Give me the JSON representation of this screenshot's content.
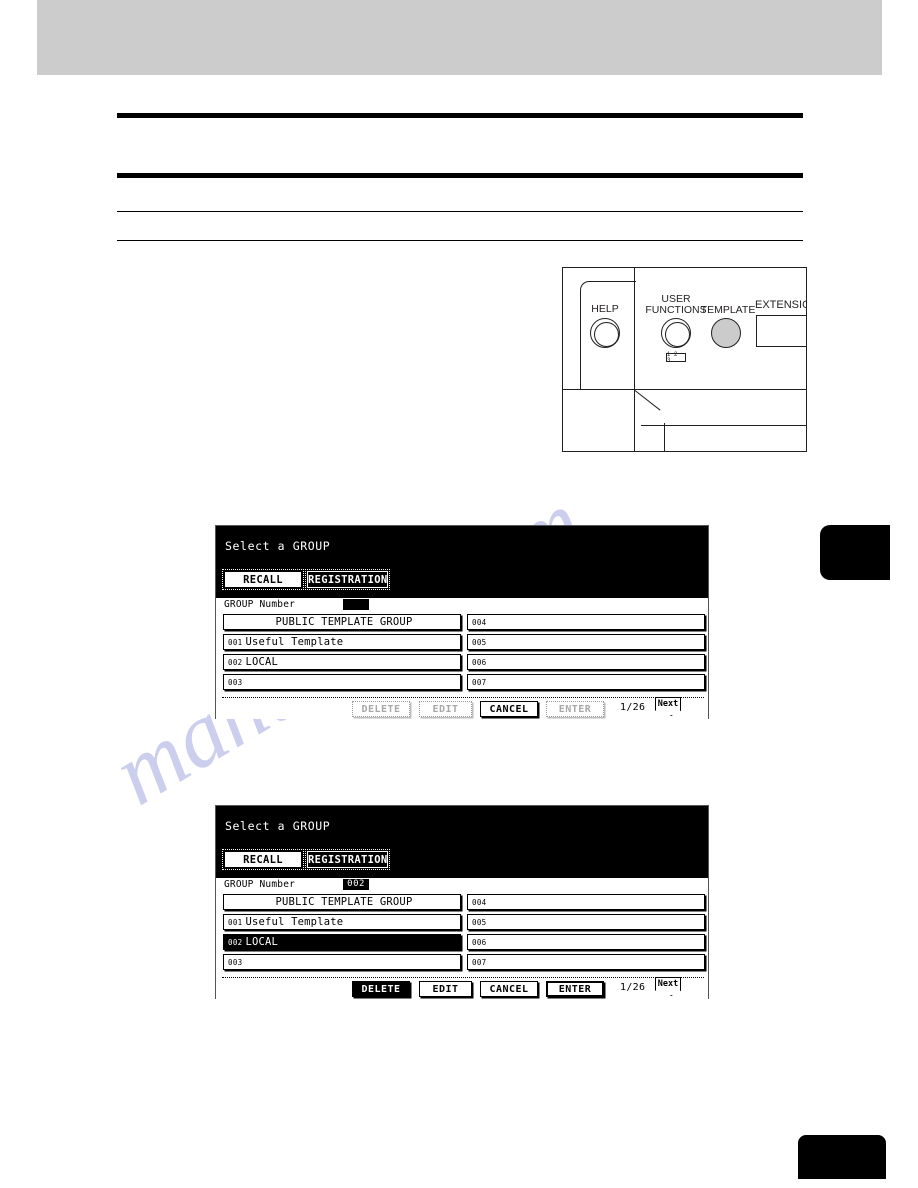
{
  "page": {
    "watermark_line1": "manualshive",
    "watermark_line2": ".com"
  },
  "control_panel": {
    "keys": [
      {
        "name": "help-key",
        "label_line1": "HELP",
        "label_line2": "",
        "state": "normal"
      },
      {
        "name": "user-functions-key",
        "label_line1": "USER",
        "label_line2": "FUNCTIONS",
        "state": "normal",
        "badge": "1 2 3"
      },
      {
        "name": "template-key",
        "label_line1": "TEMPLATE",
        "label_line2": "",
        "state": "highlighted"
      }
    ],
    "extension_label": "EXTENSION"
  },
  "screens": [
    {
      "id": "screen-recall",
      "title": "Select a GROUP",
      "tabs": [
        {
          "label": "RECALL",
          "active": false
        },
        {
          "label": "REGISTRATION",
          "active": true
        }
      ],
      "group_number": {
        "label": "GROUP Number",
        "value": ""
      },
      "groups_left": [
        {
          "index": "",
          "name": "PUBLIC TEMPLATE GROUP",
          "selected": false,
          "centered": true
        },
        {
          "index": "001",
          "name": "Useful Template",
          "selected": false,
          "centered": false
        },
        {
          "index": "002",
          "name": "LOCAL",
          "selected": false,
          "centered": false
        },
        {
          "index": "003",
          "name": "",
          "selected": false,
          "centered": false
        }
      ],
      "groups_right": [
        {
          "index": "004",
          "name": "",
          "selected": false,
          "centered": false
        },
        {
          "index": "005",
          "name": "",
          "selected": false,
          "centered": false
        },
        {
          "index": "006",
          "name": "",
          "selected": false,
          "centered": false
        },
        {
          "index": "007",
          "name": "",
          "selected": false,
          "centered": false
        }
      ],
      "buttons": [
        {
          "label": "DELETE",
          "state": "dim"
        },
        {
          "label": "EDIT",
          "state": "dim"
        },
        {
          "label": "CANCEL",
          "state": "normal"
        },
        {
          "label": "ENTER",
          "state": "dim"
        }
      ],
      "page_count": "1/26",
      "next_label": "Next"
    },
    {
      "id": "screen-group-selected",
      "title": "Select a GROUP",
      "tabs": [
        {
          "label": "RECALL",
          "active": false
        },
        {
          "label": "REGISTRATION",
          "active": true
        }
      ],
      "group_number": {
        "label": "GROUP Number",
        "value": "002"
      },
      "groups_left": [
        {
          "index": "",
          "name": "PUBLIC TEMPLATE GROUP",
          "selected": false,
          "centered": true
        },
        {
          "index": "001",
          "name": "Useful Template",
          "selected": false,
          "centered": false
        },
        {
          "index": "002",
          "name": "LOCAL",
          "selected": true,
          "centered": false
        },
        {
          "index": "003",
          "name": "",
          "selected": false,
          "centered": false
        }
      ],
      "groups_right": [
        {
          "index": "004",
          "name": "",
          "selected": false,
          "centered": false
        },
        {
          "index": "005",
          "name": "",
          "selected": false,
          "centered": false
        },
        {
          "index": "006",
          "name": "",
          "selected": false,
          "centered": false
        },
        {
          "index": "007",
          "name": "",
          "selected": false,
          "centered": false
        }
      ],
      "buttons": [
        {
          "label": "DELETE",
          "state": "inverted"
        },
        {
          "label": "EDIT",
          "state": "normal"
        },
        {
          "label": "CANCEL",
          "state": "normal"
        },
        {
          "label": "ENTER",
          "state": "emphasis"
        }
      ],
      "page_count": "1/26",
      "next_label": "Next"
    }
  ],
  "colors": {
    "header_band": "#cccccc",
    "ink": "#000000",
    "watermark": "#c3c6ea",
    "key_highlight": "#cbcbcb"
  }
}
